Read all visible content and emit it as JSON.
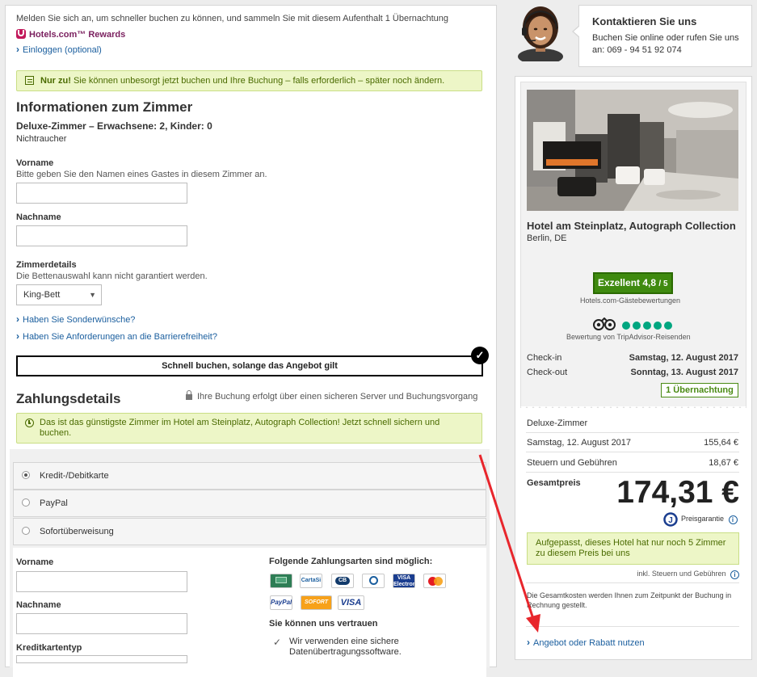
{
  "signin": {
    "intro": "Melden Sie sich an, um schneller buchen zu können, und sammeln Sie mit diesem Aufenthalt 1 Übernachtung",
    "rewards": "Hotels.com™ Rewards",
    "login_link": "Einloggen (optional)"
  },
  "notice_top": {
    "bold": "Nur zu!",
    "text": " Sie können unbesorgt jetzt buchen und Ihre Buchung – falls erforderlich – später noch ändern."
  },
  "room": {
    "section_title": "Informationen zum Zimmer",
    "room_title": "Deluxe-Zimmer – Erwachsene: 2, Kinder: 0",
    "smoking": "Nichtraucher",
    "firstname_label": "Vorname",
    "firstname_hint": "Bitte geben Sie den Namen eines Gastes in diesem Zimmer an.",
    "firstname_value": "",
    "lastname_label": "Nachname",
    "lastname_value": "",
    "details_label": "Zimmerdetails",
    "details_hint": "Die Bettenauswahl kann nicht garantiert werden.",
    "bed_selected": "King-Bett",
    "special_link": "Haben Sie Sonderwünsche?",
    "access_link": "Haben Sie Anforderungen an die Barrierefreiheit?"
  },
  "quick_book": "Schnell buchen, solange das Angebot gilt",
  "payment": {
    "section_title": "Zahlungsdetails",
    "secure_text": "Ihre Buchung erfolgt über einen sicheren Server und Buchungsvorgang",
    "cheapest_notice": "Das ist das günstigste Zimmer im Hotel am Steinplatz, Autograph Collection! Jetzt schnell sichern und buchen.",
    "options": [
      "Kredit-/Debitkarte",
      "PayPal",
      "Sofortüberweisung"
    ],
    "selected_option": "Kredit-/Debitkarte",
    "firstname_label": "Vorname",
    "lastname_label": "Nachname",
    "cardtype_label": "Kreditkartentyp",
    "accepted_title": "Folgende Zahlungsarten sind möglich:",
    "cards_row1": [
      "",
      "CartaSi",
      "CB",
      "Diners Club",
      "VISA Electron",
      "MasterCard"
    ],
    "cards_row2": [
      "PayPal",
      "SOFORT",
      "VISA"
    ],
    "trust_title": "Sie können uns vertrauen",
    "trust_item": "Wir verwenden eine sichere Datenübertragungssoftware."
  },
  "contact": {
    "title": "Kontaktieren Sie uns",
    "text": "Buchen Sie online oder rufen Sie uns an: 069 - 94 51 92 074"
  },
  "hotel": {
    "name": "Hotel am Steinplatz, Autograph Collection",
    "location": "Berlin, DE",
    "rating_word": "Exzellent",
    "rating_value": "4,8",
    "rating_scale": "/ 5",
    "rating_source": "Hotels.com-Gästebewertungen",
    "tripadvisor_text": "Bewertung von TripAdvisor-Reisenden",
    "tripadvisor_circles": 5,
    "checkin_label": "Check-in",
    "checkin_value": "Samstag, 12. August 2017",
    "checkout_label": "Check-out",
    "checkout_value": "Sonntag, 13. August 2017",
    "nights": "1 Übernachtung"
  },
  "price": {
    "room_type": "Deluxe-Zimmer",
    "night_label": "Samstag, 12. August 2017",
    "night_value": "155,64 €",
    "tax_label": "Steuern und Gebühren",
    "tax_value": "18,67 €",
    "total_label": "Gesamtpreis",
    "total_value": "174,31 €",
    "guarantee": "Preisgarantie",
    "urgency": "Aufgepasst, dieses Hotel hat nur noch 5 Zimmer zu diesem Preis bei uns",
    "incl_tax": "inkl. Steuern und Gebühren",
    "charge_note": "Die Gesamtkosten werden Ihnen zum Zeitpunkt der Buchung in Rechnung gestellt.",
    "coupon_link": "Angebot oder Rabatt nutzen"
  },
  "colors": {
    "link": "#1a5e9e",
    "notice_bg": "#edf6c7",
    "rating_green": "#3f8a0f",
    "annotation_arrow": "#e8262c"
  }
}
